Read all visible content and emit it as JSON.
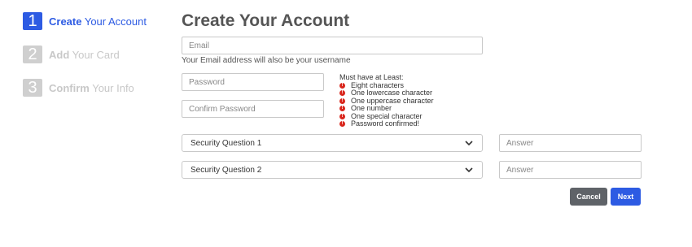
{
  "steps": [
    {
      "number": "1",
      "label_bold": "Create",
      "label_rest": " Your Account",
      "state": "active"
    },
    {
      "number": "2",
      "label_bold": "Add",
      "label_rest": " Your Card",
      "state": "inactive"
    },
    {
      "number": "3",
      "label_bold": "Confirm",
      "label_rest": " Your Info",
      "state": "inactive"
    }
  ],
  "form": {
    "title": "Create Your Account",
    "email_placeholder": "Email",
    "email_hint": "Your Email address will also be your username",
    "password_placeholder": "Password",
    "confirm_password_placeholder": "Confirm Password",
    "requirements_title": "Must have at Least:",
    "requirements": [
      "Eight characters",
      "One lowercase character",
      "One uppercase character",
      "One number",
      "One special character",
      "Password confirmed!"
    ],
    "requirement_icon": "exclamation-icon",
    "security_question_1": "Security Question 1",
    "security_question_2": "Security Question 2",
    "answer_placeholder": "Answer",
    "cancel_label": "Cancel",
    "next_label": "Next"
  },
  "colors": {
    "accent": "#2d5be3",
    "cancel": "#5f6368",
    "error": "#d9261c",
    "inactive": "#cfcfcf"
  }
}
